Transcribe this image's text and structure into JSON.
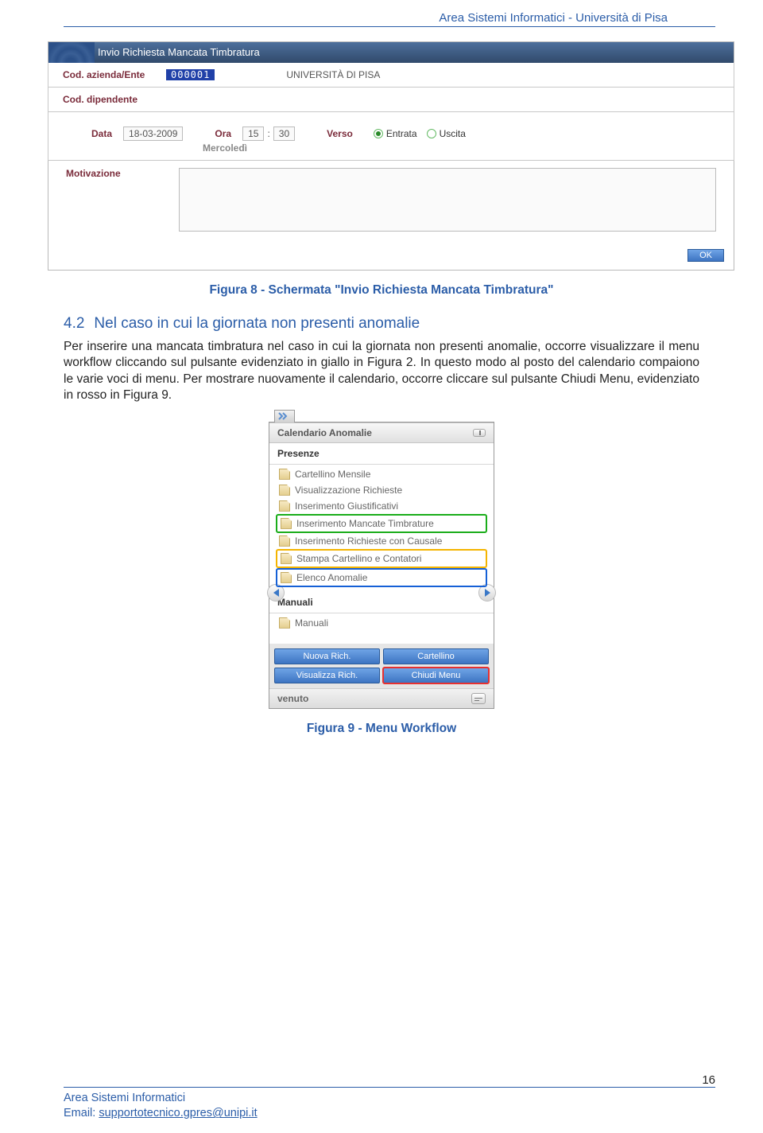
{
  "header": "Area Sistemi Informatici  - Università di Pisa",
  "form": {
    "title": "Invio Richiesta Mancata Timbratura",
    "row1": {
      "label": "Cod. azienda/Ente",
      "code": "000001",
      "org": "UNIVERSITÀ DI PISA"
    },
    "row2": {
      "label": "Cod. dipendente"
    },
    "details": {
      "data_label": "Data",
      "data_val": "18-03-2009",
      "day": "Mercoledì",
      "ora_label": "Ora",
      "hh": "15",
      "mm": "30",
      "verso_label": "Verso",
      "entrata": "Entrata",
      "uscita": "Uscita"
    },
    "motiv_label": "Motivazione",
    "ok": "OK"
  },
  "caption1": "Figura 8 - Schermata \"Invio Richiesta Mancata Timbratura\"",
  "section": {
    "num": "4.2",
    "title": "Nel caso in cui la giornata non presenti anomalie"
  },
  "paragraph": "Per inserire una mancata timbratura nel caso in cui la giornata non presenti anomalie, occorre visualizzare il menu workflow cliccando sul pulsante evidenziato in giallo in Figura 2. In questo modo al posto del calendario compaiono le varie voci di menu. Per mostrare nuovamente il calendario, occorre cliccare sul pulsante Chiudi Menu, evidenziato in rosso in Figura 9.",
  "menu": {
    "header1": "Calendario Anomalie",
    "sub1": "Presenze",
    "items": [
      "Cartellino Mensile",
      "Visualizzazione Richieste",
      "Inserimento Giustificativi",
      "Inserimento Mancate Timbrature",
      "Inserimento Richieste con Causale",
      "Stampa Cartellino e Contatori",
      "Elenco Anomalie"
    ],
    "sub2": "Manuali",
    "items2": [
      "Manuali"
    ],
    "buttons": [
      "Nuova Rich.",
      "Cartellino",
      "Visualizza Rich.",
      "Chiudi Menu"
    ],
    "footer": "venuto"
  },
  "caption2": "Figura 9 - Menu Workflow",
  "footer": {
    "line1": "Area Sistemi Informatici",
    "line2_prefix": "Email: ",
    "email": "supportotecnico.gpres@unipi.it",
    "page": "16"
  }
}
